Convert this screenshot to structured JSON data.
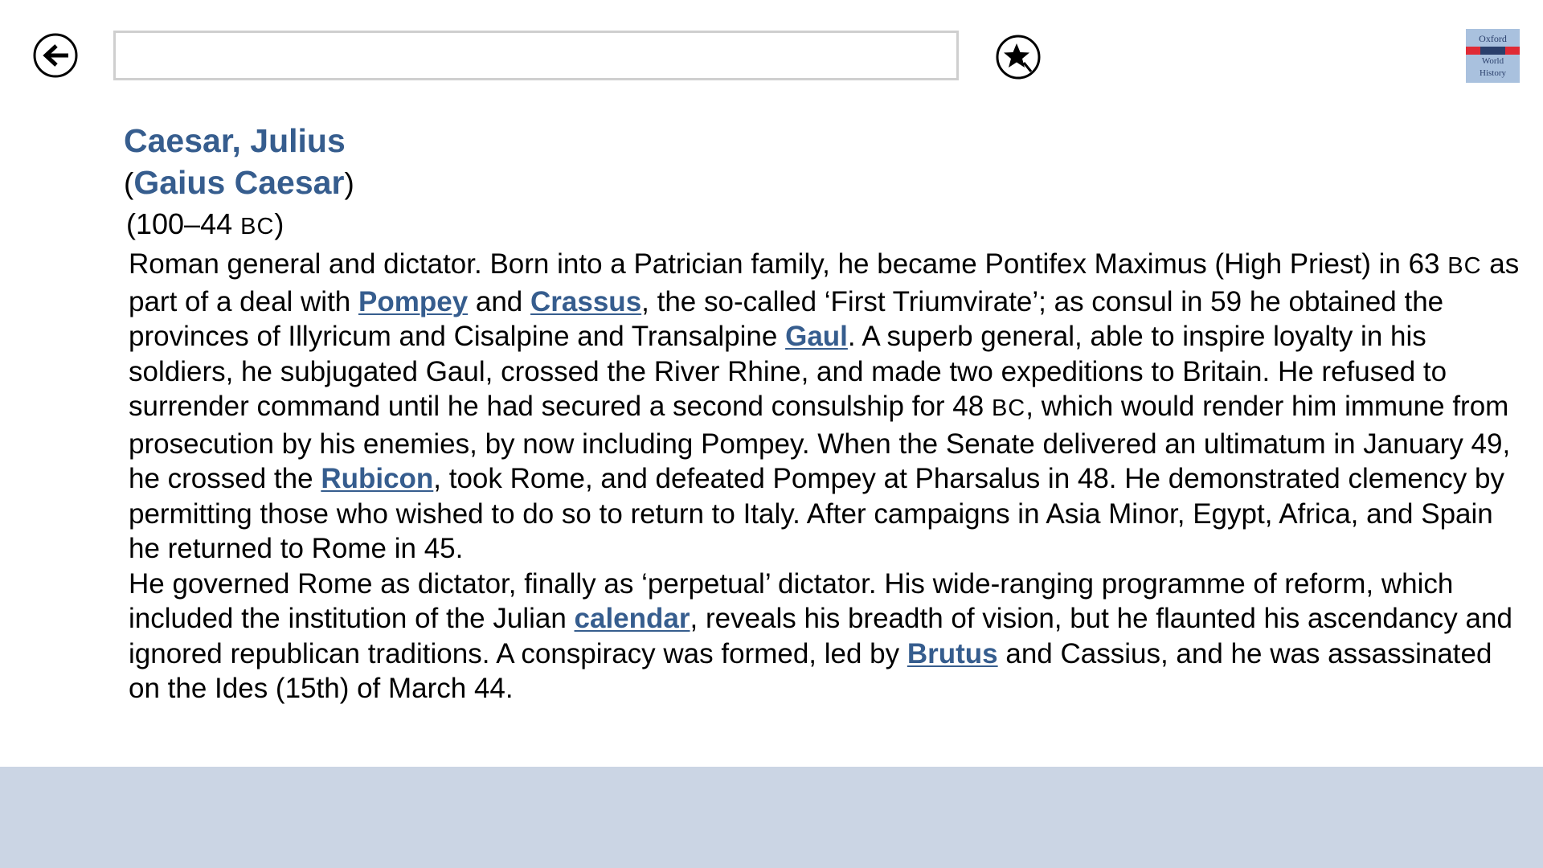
{
  "header": {
    "back_icon": "back-arrow-icon",
    "search": {
      "value": "",
      "placeholder": ""
    },
    "favorite_icon": "star-icon",
    "logo": {
      "line1": "Oxford",
      "line2": "World",
      "line3": "History"
    }
  },
  "entry": {
    "headword": "Caesar, Julius",
    "alt_name_open": "(",
    "alt_name": "Gaius Caesar",
    "alt_name_close": ")",
    "dates_open": "(100–44 ",
    "dates_era": "BC",
    "dates_close": ")",
    "para1": {
      "t1": "Roman general and dictator. Born into a Patrician family, he became Pontifex Maximus (High Priest) in 63 ",
      "era1": "BC",
      "t2": " as part of a deal with ",
      "link_pompey": "Pompey",
      "t3": " and ",
      "link_crassus": "Crassus",
      "t4": ", the so-called ‘First Triumvirate’; as consul in 59 he obtained the provinces of Illyricum and Cisalpine and Transalpine ",
      "link_gaul": "Gaul",
      "t5": ". A superb general, able to inspire loyalty in his soldiers, he subjugated Gaul, crossed the River Rhine, and made two expeditions to Britain. He refused to surrender command until he had secured a second consulship for 48 ",
      "era2": "BC",
      "t6": ", which would render him immune from prosecution by his enemies, by now including Pompey. When the Senate delivered an ultimatum in January 49, he crossed the ",
      "link_rubicon": "Rubicon",
      "t7": ", took Rome, and defeated Pompey at Pharsalus in 48. He demonstrated clemency by permitting those who wished to do so to return to Italy. After campaigns in Asia Minor, Egypt, Africa, and Spain he returned to Rome in 45."
    },
    "para2": {
      "t1": "He governed Rome as dictator, finally as ‘perpetual’ dictator. His wide-ranging programme of reform, which included the institution of the Julian ",
      "link_calendar": "calendar",
      "t2": ", reveals his breadth of vision, but he flaunted his ascendancy and ignored republican traditions. A conspiracy was formed, led by ",
      "link_brutus": "Brutus",
      "t3": " and Cassius, and he was assassinated on the Ides (15th) of March 44."
    }
  },
  "colors": {
    "link": "#365d8e",
    "footer": "#cbd5e4",
    "logo_bg": "#a9c1de",
    "logo_red": "#e02a35"
  }
}
